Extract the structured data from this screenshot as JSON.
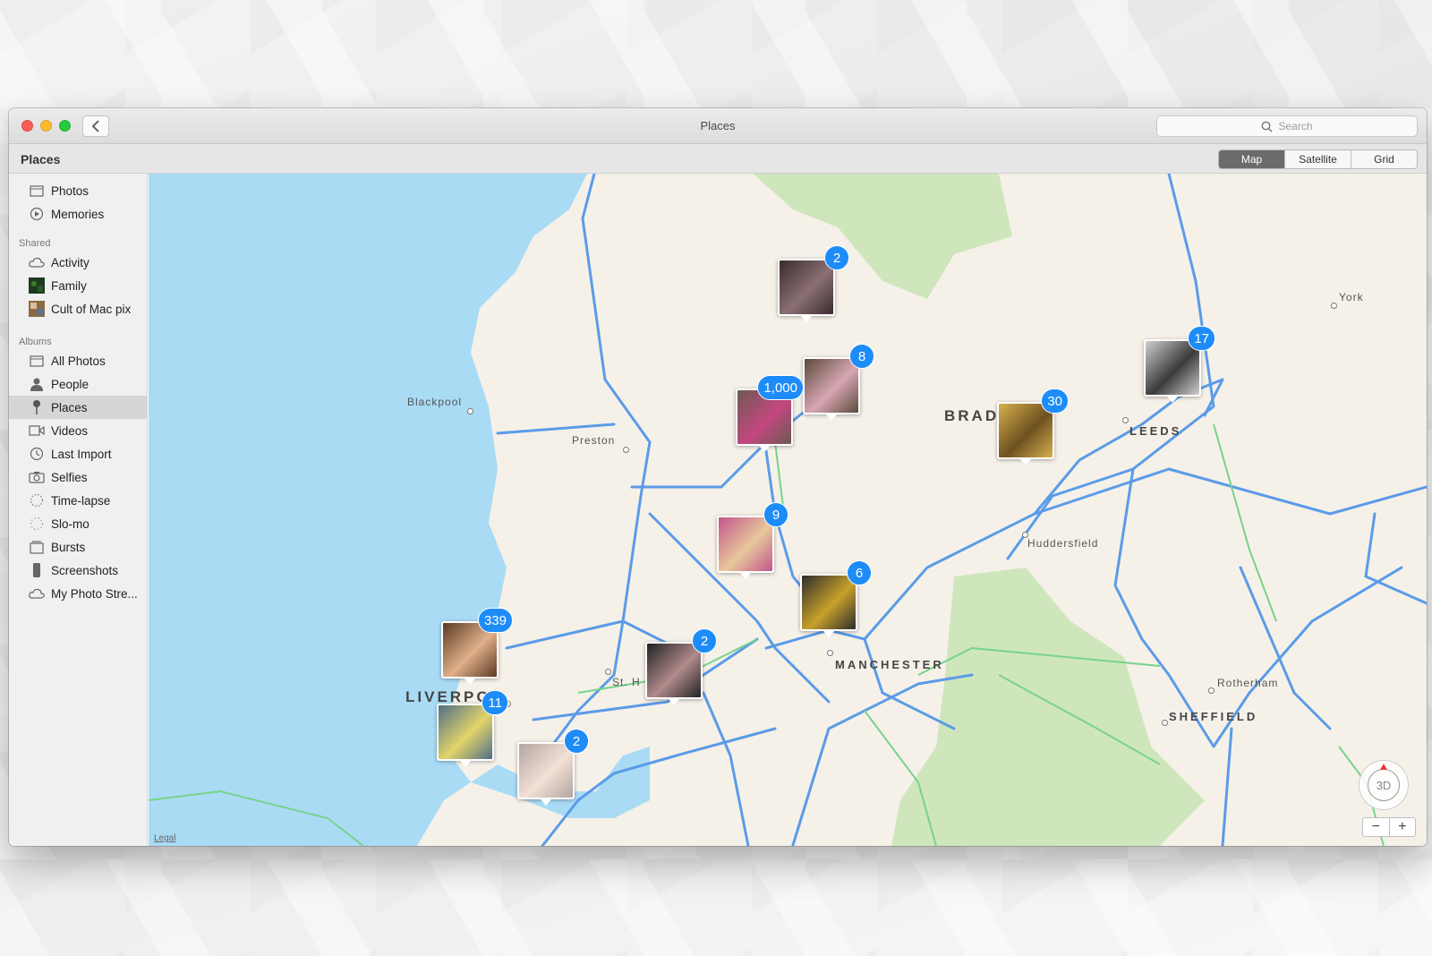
{
  "window": {
    "title": "Places",
    "search_placeholder": "Search"
  },
  "toolbar": {
    "title": "Places",
    "segments": [
      "Map",
      "Satellite",
      "Grid"
    ],
    "selected": "Map"
  },
  "sidebar": {
    "top_items": [
      {
        "label": "Photos",
        "icon": "photos-icon"
      },
      {
        "label": "Memories",
        "icon": "memories-icon"
      }
    ],
    "shared_header": "Shared",
    "shared_items": [
      {
        "label": "Activity",
        "icon": "cloud-icon"
      },
      {
        "label": "Family",
        "icon": "album-thumbnail-icon"
      },
      {
        "label": "Cult of Mac pix",
        "icon": "album-thumbnail-icon"
      }
    ],
    "albums_header": "Albums",
    "album_items": [
      {
        "label": "All Photos",
        "icon": "photos-icon"
      },
      {
        "label": "People",
        "icon": "person-icon"
      },
      {
        "label": "Places",
        "icon": "pin-icon",
        "active": true
      },
      {
        "label": "Videos",
        "icon": "video-icon"
      },
      {
        "label": "Last Import",
        "icon": "clock-icon"
      },
      {
        "label": "Selfies",
        "icon": "camera-icon"
      },
      {
        "label": "Time-lapse",
        "icon": "timelapse-icon"
      },
      {
        "label": "Slo-mo",
        "icon": "slomo-icon"
      },
      {
        "label": "Bursts",
        "icon": "bursts-icon"
      },
      {
        "label": "Screenshots",
        "icon": "phone-icon"
      },
      {
        "label": "My Photo Stre...",
        "icon": "cloud-icon"
      }
    ]
  },
  "map": {
    "places": {
      "blackpool": "Blackpool",
      "preston": "Preston",
      "york": "York",
      "huddersfield": "Huddersfield",
      "rotherham": "Rotherham",
      "st_h": "St. H"
    },
    "cities": {
      "bradford": "BRADF",
      "leeds": "LEEDS",
      "manchester": "MANCHESTER",
      "sheffield": "SHEFFIELD",
      "liverpool": "LIVERPO"
    },
    "pins": [
      {
        "count": "2",
        "colors": [
          "#3a2c2c",
          "#8a6f74"
        ]
      },
      {
        "count": "8",
        "colors": [
          "#5b4a3a",
          "#d8a7b4"
        ]
      },
      {
        "count": "1,000",
        "colors": [
          "#6e5a52",
          "#c2477e"
        ]
      },
      {
        "count": "30",
        "colors": [
          "#d8b04d",
          "#6d5120"
        ]
      },
      {
        "count": "17",
        "colors": [
          "#cfcfcf",
          "#3b3b3b"
        ]
      },
      {
        "count": "9",
        "colors": [
          "#c2568c",
          "#e8c79b"
        ]
      },
      {
        "count": "6",
        "colors": [
          "#2c2c2c",
          "#c9a12b"
        ]
      },
      {
        "count": "339",
        "colors": [
          "#5a3a22",
          "#e0b08a"
        ]
      },
      {
        "count": "2",
        "colors": [
          "#222222",
          "#b08a8a"
        ]
      },
      {
        "count": "11",
        "colors": [
          "#4f6f87",
          "#e3d46a"
        ]
      },
      {
        "count": "2",
        "colors": [
          "#b5a5a0",
          "#f2e0d6"
        ]
      }
    ],
    "legal": "Legal",
    "compass_label": "3D",
    "zoom_out": "−",
    "zoom_in": "+"
  },
  "colors": {
    "water": "#a9dbf5",
    "land": "#f5f1e9",
    "parks": "#cfe6bd",
    "roads": "#5b9be8",
    "minor_roads": "#77d38a",
    "badge": "#1d8cf8"
  }
}
